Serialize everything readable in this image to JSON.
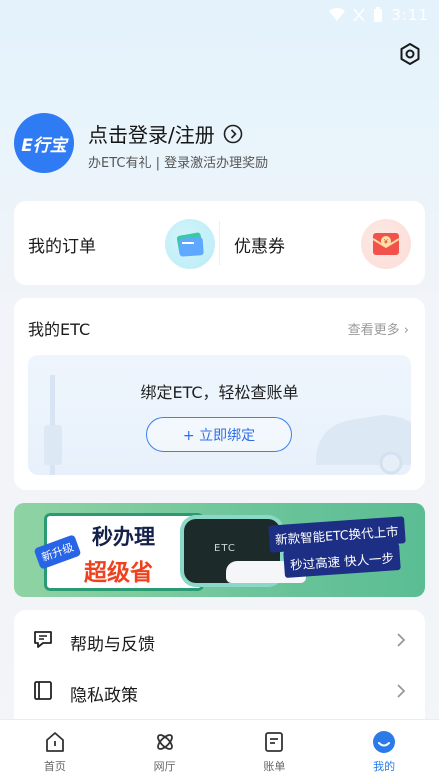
{
  "status_bar": {
    "time": "3:11"
  },
  "profile": {
    "logo_text": "E行宝",
    "login_title": "点击登录/注册",
    "login_subtitle": "办ETC有礼 | 登录激活办理奖励"
  },
  "quick": {
    "orders_label": "我的订单",
    "coupons_label": "优惠券",
    "orders_icon": "wallet-card-icon",
    "coupons_icon": "red-envelope-icon"
  },
  "etc": {
    "title": "我的ETC",
    "more": "查看更多",
    "message": "绑定ETC，轻松查账单",
    "bind_button": "+ 立即绑定"
  },
  "banner": {
    "badge": "新升级",
    "title_line1": "秒办理",
    "title_line2": "超级省",
    "device_text": "ETC",
    "tag1": "新款智能ETC换代上市",
    "tag2": "秒过高速 快人一步"
  },
  "menu": {
    "items": [
      {
        "label": "帮助与反馈",
        "icon": "help-feedback-icon"
      },
      {
        "label": "隐私政策",
        "icon": "privacy-book-icon"
      }
    ]
  },
  "tabs": [
    {
      "label": "首页",
      "icon": "home-icon"
    },
    {
      "label": "网厅",
      "icon": "hall-icon"
    },
    {
      "label": "账单",
      "icon": "bill-icon"
    },
    {
      "label": "我的",
      "icon": "profile-icon"
    }
  ],
  "active_tab": "我的",
  "colors": {
    "accent": "#2f7bf3",
    "banner_green": "#6cc49a"
  }
}
